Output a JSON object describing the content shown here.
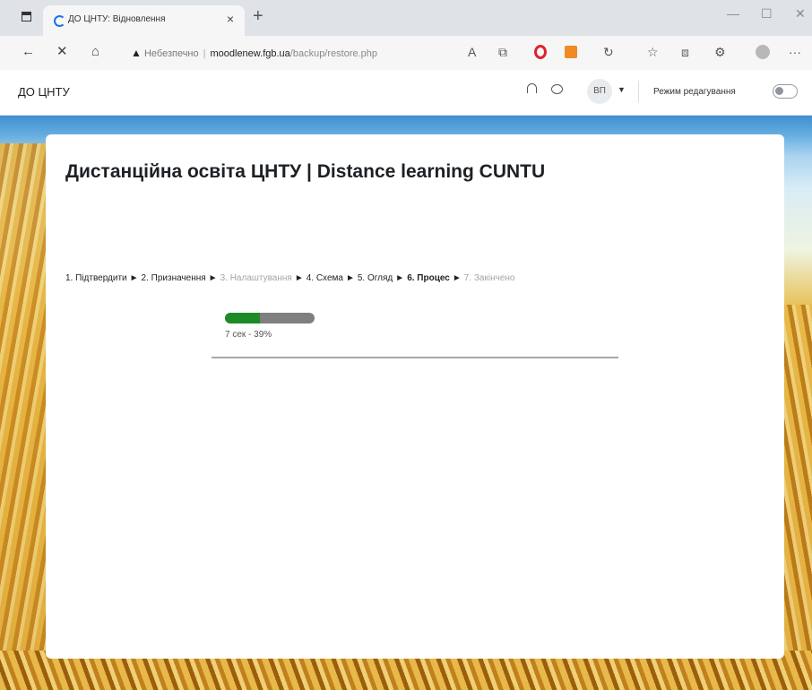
{
  "browser": {
    "tab_title": "ДО ЦНТУ: Відновлення",
    "tab_close": "×",
    "new_tab": "+",
    "address": {
      "security_label": "Небезпечно",
      "host": "moodlenew.fgb.ua",
      "path": "/backup/restore.php"
    },
    "window_controls": {
      "minimize": "—",
      "maximize": "☐",
      "close": "✕"
    },
    "toolbar_icons": [
      "read-aloud-icon",
      "tab-search-icon",
      "opera-icon",
      "extension-icon",
      "refresh-icon",
      "favorites-icon",
      "collections-icon",
      "settings-icon",
      "profile-icon",
      "more-icon"
    ],
    "more_label": "···"
  },
  "navbar": {
    "site_name": "ДО ЦНТУ",
    "user_initials": "ВП",
    "edit_mode_label": "Режим редагування",
    "edit_mode_on": false
  },
  "page": {
    "title": "Дистанційна освіта ЦНТУ | Distance learning CUNTU",
    "stages": [
      {
        "label": "1. Підтвердити",
        "state": "done"
      },
      {
        "label": "2. Призначення",
        "state": "done"
      },
      {
        "label": "3. Налаштування",
        "state": "pending"
      },
      {
        "label": "4. Схема",
        "state": "done"
      },
      {
        "label": "5. Огляд",
        "state": "done"
      },
      {
        "label": "6. Процес",
        "state": "current"
      },
      {
        "label": "7. Закінчено",
        "state": "pending"
      }
    ],
    "stage_arrow": "►",
    "progress": {
      "percent": 39,
      "text": "7 сек - 39%"
    }
  },
  "colors": {
    "progress_fill": "#1e8a26",
    "progress_track": "#7f7f7f",
    "security_warning": "#222222"
  }
}
